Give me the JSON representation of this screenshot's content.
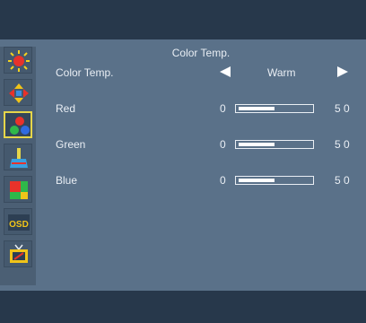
{
  "title": "Color Temp.",
  "menu_icons": [
    {
      "name": "brightness-icon",
      "selected": false
    },
    {
      "name": "position-icon",
      "selected": false
    },
    {
      "name": "color-icon",
      "selected": true
    },
    {
      "name": "image-setup-icon",
      "selected": false
    },
    {
      "name": "color-boost-icon",
      "selected": false
    },
    {
      "name": "osd-icon",
      "selected": false
    },
    {
      "name": "setup-icon",
      "selected": false
    }
  ],
  "osd_icon_text": "OSD",
  "color_temp": {
    "label": "Color Temp.",
    "value": "Warm"
  },
  "rows": [
    {
      "label": "Red",
      "min": "0",
      "value": "5 0",
      "level": 0.5
    },
    {
      "label": "Green",
      "min": "0",
      "value": "5 0",
      "level": 0.5
    },
    {
      "label": "Blue",
      "min": "0",
      "value": "5 0",
      "level": 0.5
    }
  ],
  "colors": {
    "background": "#5a7189",
    "bar": "#27384b",
    "text": "#e9eef4",
    "selected_border": "#e6d64a"
  }
}
